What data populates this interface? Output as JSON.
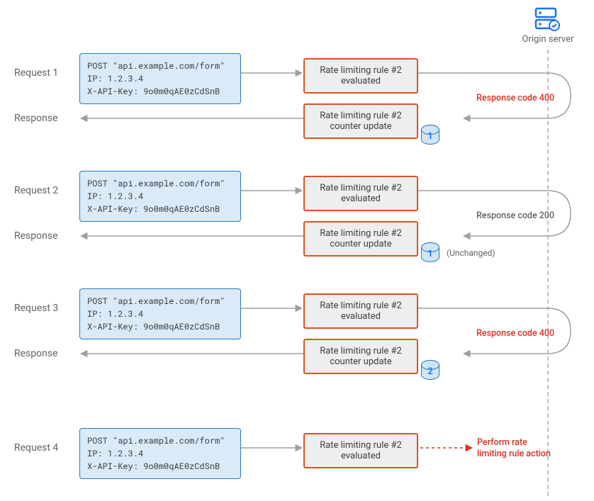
{
  "origin": {
    "label": "Origin server"
  },
  "request_content": {
    "line1": "POST \"api.example.com/form\"",
    "line2": "IP: 1.2.3.4",
    "line3": "X-API-Key: 9o0m0qAE0zCdSnB"
  },
  "rule_eval": {
    "line1": "Rate limiting rule #2",
    "line2": "evaluated"
  },
  "rule_update": {
    "line1": "Rate limiting rule #2",
    "line2": "counter update"
  },
  "labels": {
    "req1": "Request 1",
    "req2": "Request 2",
    "req3": "Request 3",
    "req4": "Request 4",
    "resp": "Response"
  },
  "responses": {
    "r1": {
      "text": "Response code 400",
      "cls": "resp-red"
    },
    "r2": {
      "text": "Response code 200",
      "cls": "resp-gray"
    },
    "r3": {
      "text": "Response code 400",
      "cls": "resp-red"
    }
  },
  "counters": {
    "c1": "1",
    "c2": "1",
    "c3": "2"
  },
  "unchanged": "(Unchanged)",
  "action": {
    "line1": "Perform rate",
    "line2": "limiting rule action"
  }
}
